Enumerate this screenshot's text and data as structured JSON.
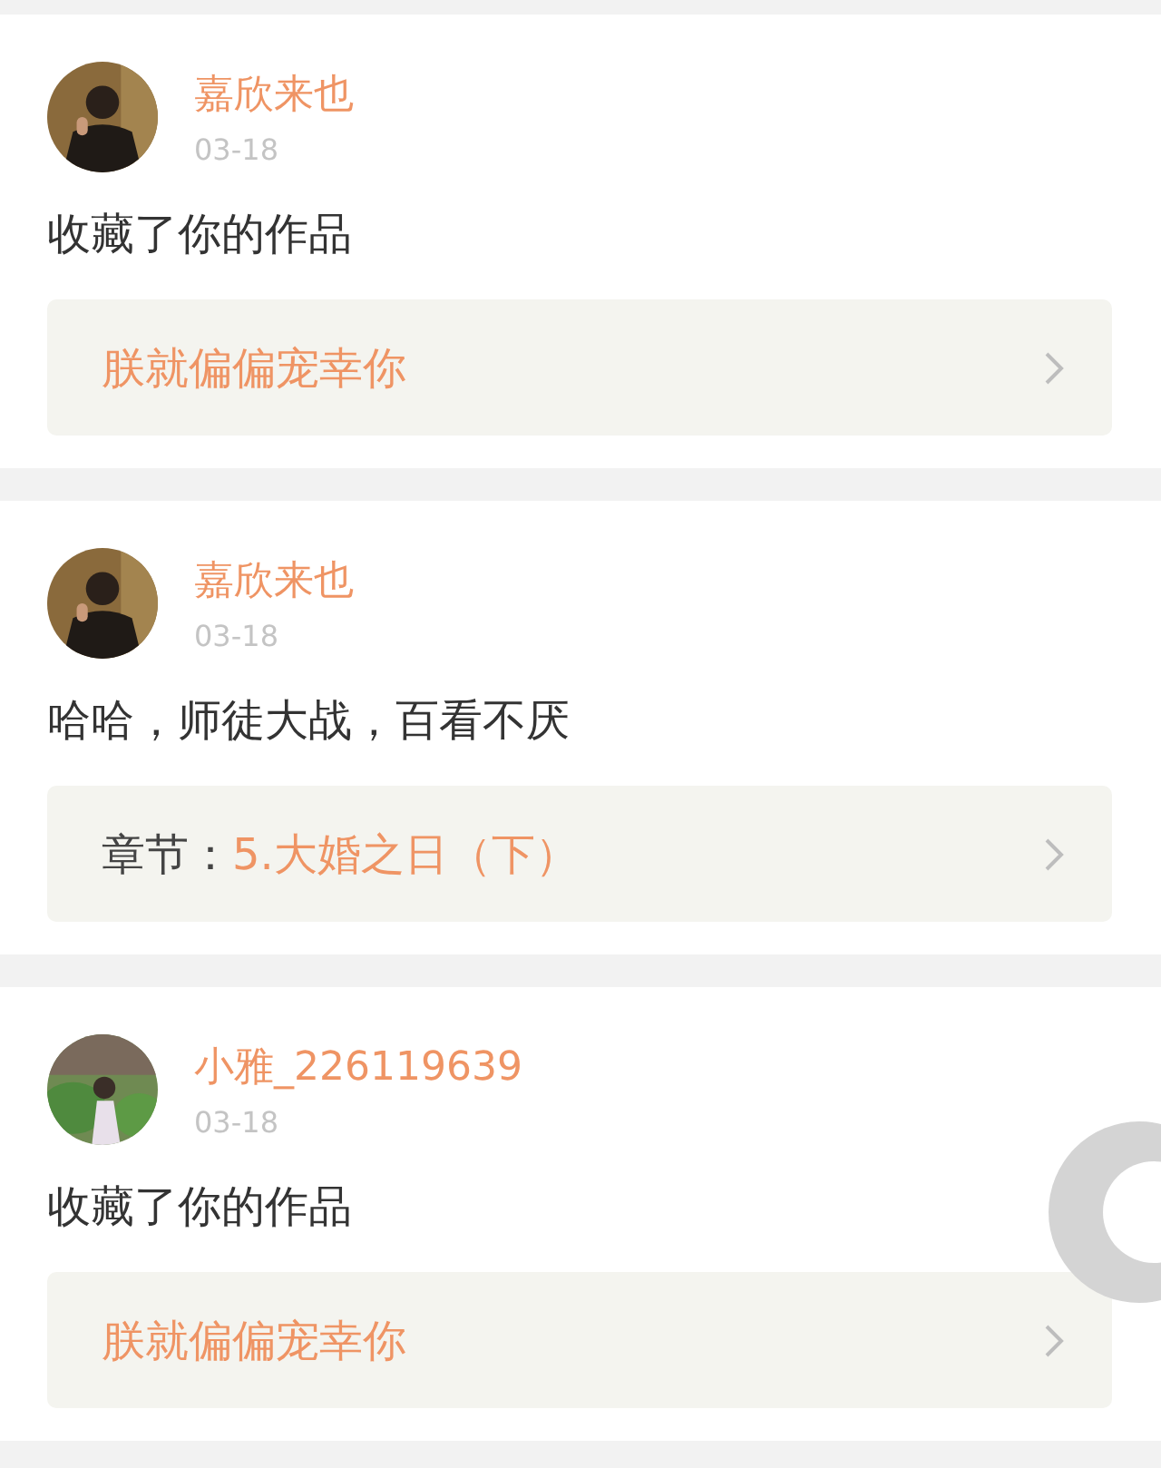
{
  "items": [
    {
      "user": "嘉欣来也",
      "date": "03-18",
      "message": "收藏了你的作品",
      "link": {
        "kind": "work",
        "title": "朕就偏偏宠幸你"
      }
    },
    {
      "user": "嘉欣来也",
      "date": "03-18",
      "message": "哈哈，师徒大战，百看不厌",
      "link": {
        "kind": "chapter",
        "label": "章节：",
        "title": "5.大婚之日（下）"
      }
    },
    {
      "user": "小雅_226119639",
      "date": "03-18",
      "message": "收藏了你的作品",
      "link": {
        "kind": "work",
        "title": "朕就偏偏宠幸你"
      }
    }
  ]
}
